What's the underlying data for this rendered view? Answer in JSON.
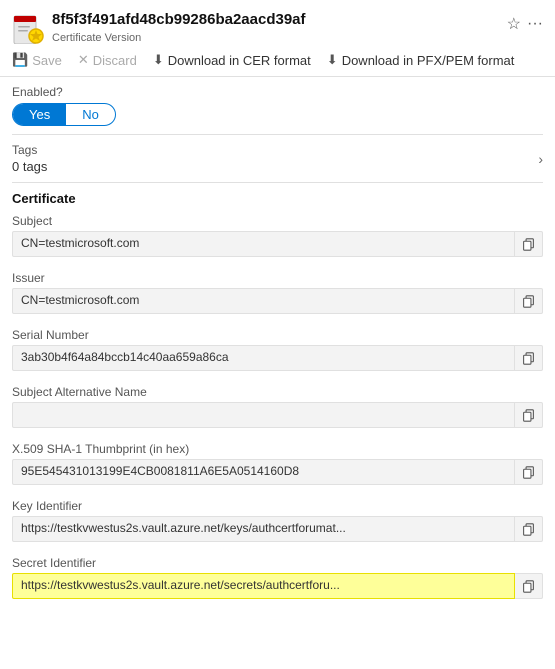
{
  "header": {
    "title": "8f5f3f491afd48cb99286ba2aacd39af",
    "subtitle": "Certificate Version",
    "pin_label": "pin",
    "more_label": "more"
  },
  "toolbar": {
    "save_label": "Save",
    "discard_label": "Discard",
    "download_cer_label": "Download in CER format",
    "download_pfx_label": "Download in PFX/PEM format"
  },
  "enabled_section": {
    "label": "Enabled?",
    "yes_label": "Yes",
    "no_label": "No",
    "active": "yes"
  },
  "tags_section": {
    "title": "Tags",
    "value": "0 tags"
  },
  "certificate_section": {
    "title": "Certificate",
    "fields": [
      {
        "label": "Subject",
        "value": "CN=testmicrosoft.com",
        "highlight": false
      },
      {
        "label": "Issuer",
        "value": "CN=testmicrosoft.com",
        "highlight": false
      },
      {
        "label": "Serial Number",
        "value": "3ab30b4f64a84bccb14c40aa659a86ca",
        "highlight": false
      },
      {
        "label": "Subject Alternative Name",
        "value": "",
        "highlight": false
      },
      {
        "label": "X.509 SHA-1 Thumbprint (in hex)",
        "value": "95E545431013199E4CB0081811A6E5A0514160D8",
        "highlight": false
      },
      {
        "label": "Key Identifier",
        "value": "https://testkvwestus2s.vault.azure.net/keys/authcertforumat...",
        "highlight": false
      },
      {
        "label": "Secret Identifier",
        "value": "https://testkvwestus2s.vault.azure.net/secrets/authcertforu...",
        "highlight": true
      }
    ]
  }
}
